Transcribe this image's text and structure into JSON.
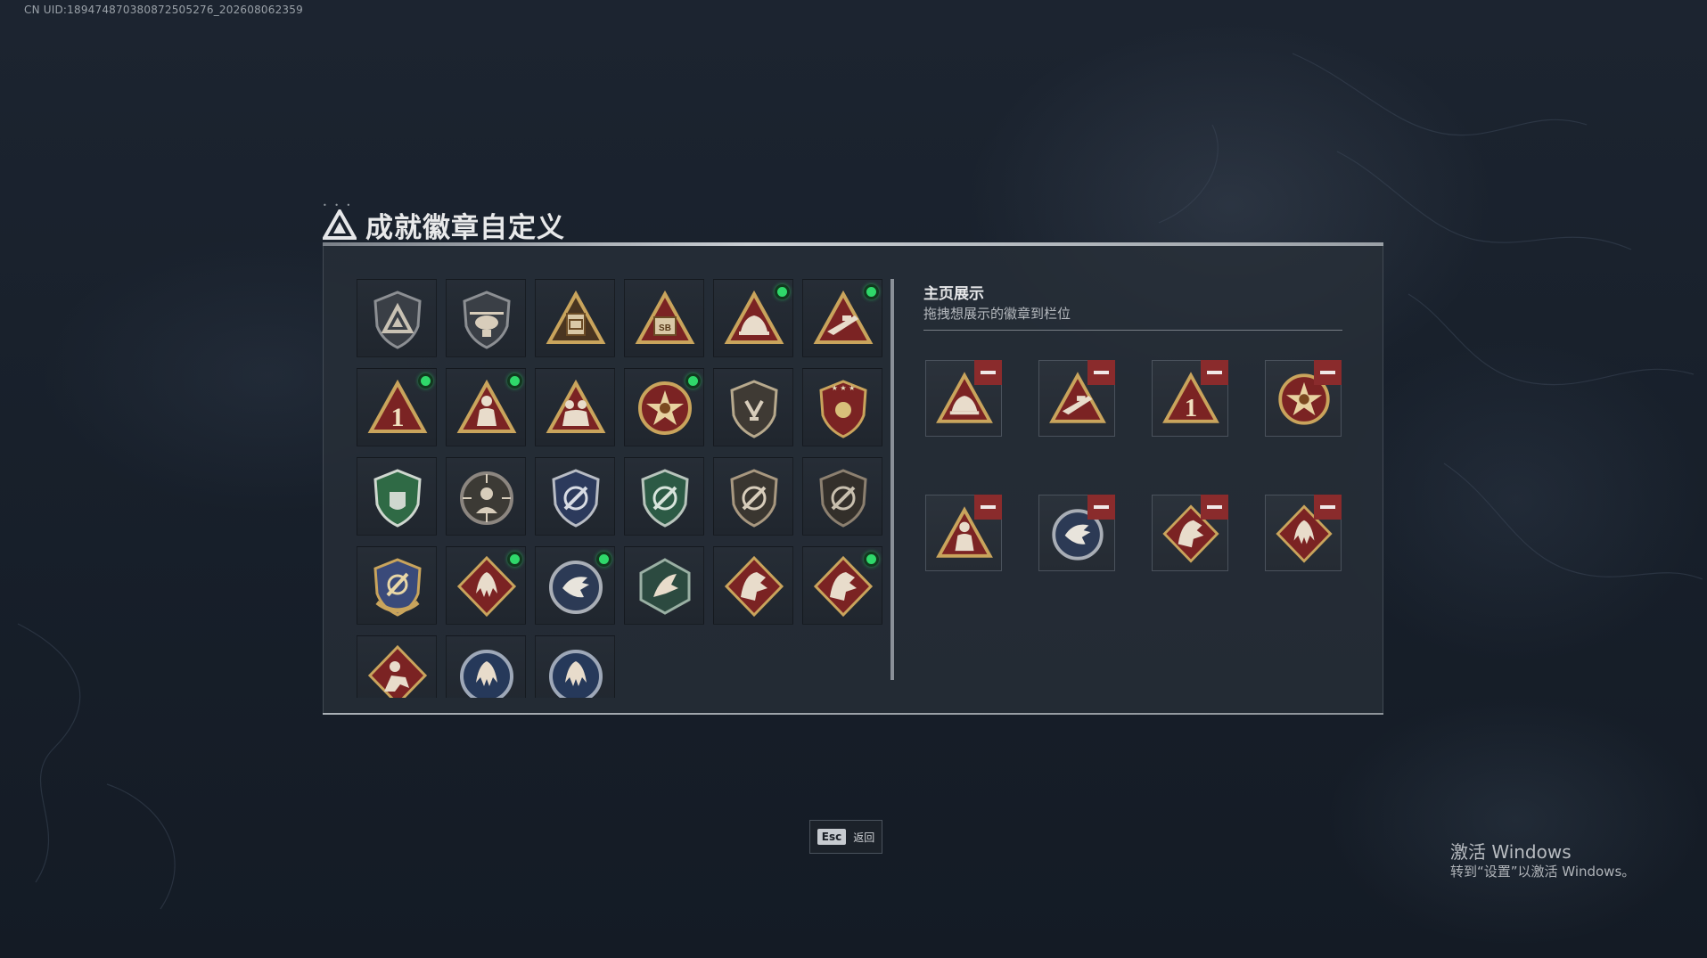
{
  "uid_text": "CN UID:18947487038087250527​6_202608062359",
  "title": "成就徽章自定义",
  "showcase": {
    "title": "主页展示",
    "subtitle": "拖拽想展示的徽章到栏位"
  },
  "badges": [
    {
      "icon": "shield-triangle-logo-badge-icon",
      "new": false
    },
    {
      "icon": "helicopter-badge-icon",
      "new": false
    },
    {
      "icon": "crate-triangle-badge-icon",
      "new": false
    },
    {
      "icon": "sb-crate-triangle-badge-icon",
      "new": false
    },
    {
      "icon": "hand-triangle-badge-icon",
      "new": true
    },
    {
      "icon": "rifle-triangle-badge-icon",
      "new": true
    },
    {
      "icon": "number-one-triangle-badge-icon",
      "new": true
    },
    {
      "icon": "soldier-triangle-badge-icon",
      "new": true
    },
    {
      "icon": "soldiers-triangle-badge-icon",
      "new": false
    },
    {
      "icon": "star-medal-badge-icon",
      "new": true
    },
    {
      "icon": "shield-emblem-badge-icon",
      "new": false
    },
    {
      "icon": "eagle-stars-shield-badge-icon",
      "new": false
    },
    {
      "icon": "green-shield-badge-icon",
      "new": false
    },
    {
      "icon": "crosshair-soldier-badge-icon",
      "new": false
    },
    {
      "icon": "crosshair-blue-shield-badge-icon",
      "new": false
    },
    {
      "icon": "crosshair-green-shield-badge-icon",
      "new": false
    },
    {
      "icon": "crosshair-shield-badge-icon",
      "new": false
    },
    {
      "icon": "crosshair-shield-dark-badge-icon",
      "new": false
    },
    {
      "icon": "crosshair-gold-shield-badge-icon",
      "new": false
    },
    {
      "icon": "wolf-diamond-badge-icon",
      "new": true
    },
    {
      "icon": "eagle-round-badge-icon",
      "new": true
    },
    {
      "icon": "wyvern-hexagon-badge-icon",
      "new": false
    },
    {
      "icon": "dragon-diamond-badge-icon",
      "new": false
    },
    {
      "icon": "dragon-diamond-alt-badge-icon",
      "new": true
    },
    {
      "icon": "operator-diamond-badge-icon",
      "new": false
    },
    {
      "icon": "wolf-round-badge-icon",
      "new": false
    },
    {
      "icon": "wolf-round-alt-badge-icon",
      "new": false
    }
  ],
  "slots": [
    {
      "icon": "hand-triangle-badge-icon"
    },
    {
      "icon": "rifle-triangle-badge-icon"
    },
    {
      "icon": "number-one-triangle-badge-icon"
    },
    {
      "icon": "star-medal-badge-icon"
    },
    {
      "icon": "soldier-triangle-badge-icon"
    },
    {
      "icon": "eagle-round-badge-icon"
    },
    {
      "icon": "dragon-diamond-badge-icon"
    },
    {
      "icon": "wolf-diamond-badge-icon"
    }
  ],
  "esc": {
    "key": "Esc",
    "label": "返回"
  },
  "watermark": {
    "title": "激活 Windows",
    "subtitle": "转到“设置”以激活 Windows。"
  },
  "colors": {
    "gold": "#c9a45c",
    "maroon": "#7b2323",
    "new_dot": "#2fd86a",
    "remove": "#8a2b2c"
  }
}
